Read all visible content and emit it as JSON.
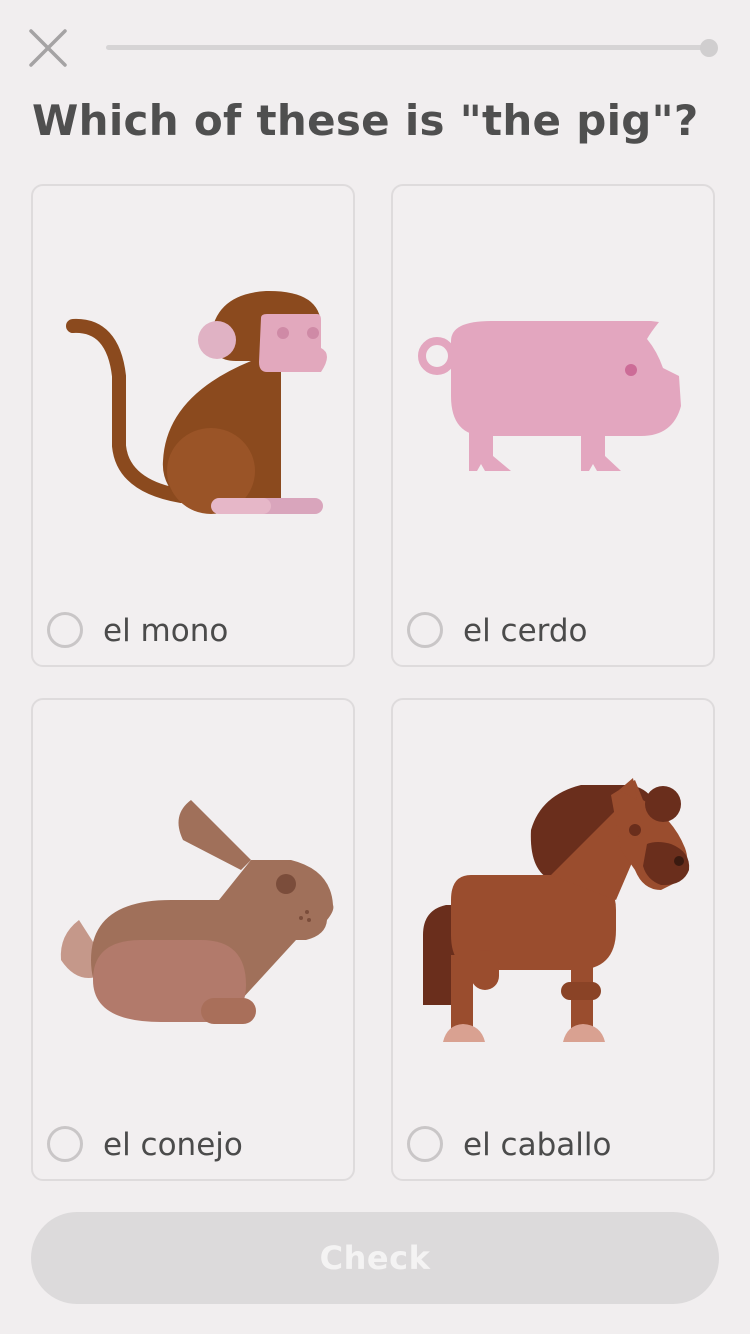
{
  "header": {
    "close_icon": "close-icon",
    "progress": 0.0
  },
  "question": {
    "text": "Which of these is \"the pig\"?"
  },
  "options": [
    {
      "label": "el mono",
      "icon": "monkey-icon",
      "selected": false
    },
    {
      "label": "el cerdo",
      "icon": "pig-icon",
      "selected": false
    },
    {
      "label": "el conejo",
      "icon": "rabbit-icon",
      "selected": false
    },
    {
      "label": "el caballo",
      "icon": "horse-icon",
      "selected": false
    }
  ],
  "footer": {
    "check_label": "Check",
    "check_enabled": false
  },
  "colors": {
    "background": "#f1eeef",
    "card_border": "#dedbdc",
    "text": "#4f4f4f",
    "check_disabled": "#dcdadb",
    "monkey": "#8b4a1e",
    "pig": "#e3a6bf",
    "rabbit": "#a0705a",
    "horse": "#9a4d2e"
  }
}
